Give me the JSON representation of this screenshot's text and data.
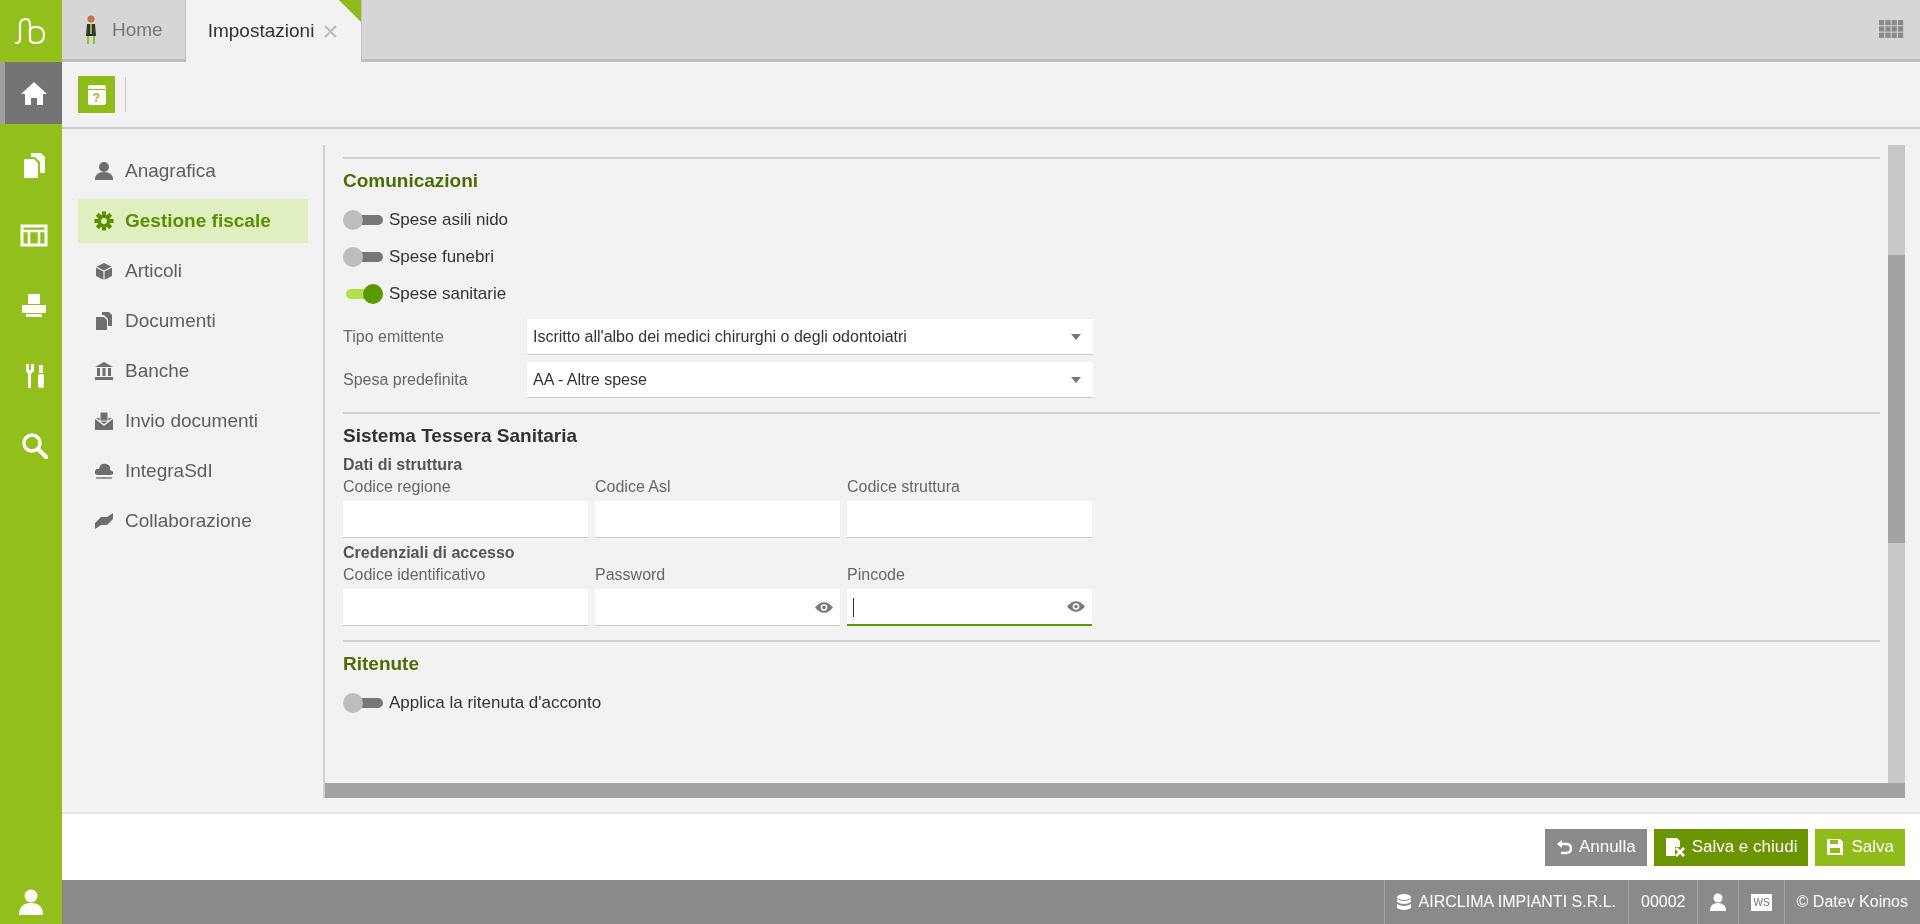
{
  "rail": [
    {
      "selected": true
    },
    {
      "selected": false
    },
    {
      "selected": false
    },
    {
      "selected": false
    },
    {
      "selected": false
    },
    {
      "selected": false
    }
  ],
  "tabs": [
    {
      "label": "Home",
      "selected": false,
      "closable": false
    },
    {
      "label": "Impostazioni",
      "selected": true,
      "closable": true
    }
  ],
  "help_button": {
    "label": "?"
  },
  "nav": [
    {
      "label": "Anagrafica",
      "selected": false
    },
    {
      "label": "Gestione fiscale",
      "selected": true
    },
    {
      "label": "Articoli",
      "selected": false
    },
    {
      "label": "Documenti",
      "selected": false
    },
    {
      "label": "Banche",
      "selected": false
    },
    {
      "label": "Invio documenti",
      "selected": false
    },
    {
      "label": "IntegraSdI",
      "selected": false
    },
    {
      "label": "Collaborazione",
      "selected": false
    }
  ],
  "sections": [
    {
      "title": "Comunicazioni",
      "accent": true,
      "toggles": [
        {
          "label": "Spese asili nido",
          "on": false
        },
        {
          "label": "Spese funebri",
          "on": false
        },
        {
          "label": "Spese sanitarie",
          "on": true
        }
      ],
      "selects": [
        {
          "label": "Tipo emittente",
          "value": "Iscritto all'albo dei medici chirurghi o degli odontoiatri"
        },
        {
          "label": "Spesa predefinita",
          "value": "AA - Altre spese"
        }
      ]
    },
    {
      "title": "Sistema Tessera Sanitaria",
      "accent": false,
      "groups": [
        {
          "title": "Dati di struttura",
          "fields": [
            {
              "label": "Codice regione",
              "reveal": false,
              "focused": false
            },
            {
              "label": "Codice Asl",
              "reveal": false,
              "focused": false
            },
            {
              "label": "Codice struttura",
              "reveal": false,
              "focused": false
            }
          ]
        },
        {
          "title": "Credenziali di accesso",
          "fields": [
            {
              "label": "Codice identificativo",
              "reveal": false,
              "focused": false
            },
            {
              "label": "Password",
              "reveal": true,
              "focused": false
            },
            {
              "label": "Pincode",
              "reveal": true,
              "focused": true
            }
          ]
        }
      ]
    },
    {
      "title": "Ritenute",
      "accent": true,
      "toggles": [
        {
          "label": "Applica la ritenuta d'acconto",
          "on": false
        }
      ]
    }
  ],
  "buttons": [
    {
      "label": "Annulla",
      "kind": "cancel"
    },
    {
      "label": "Salva e chiudi",
      "kind": "save_close"
    },
    {
      "label": "Salva",
      "kind": "save"
    }
  ],
  "status_bar": {
    "company": "AIRCLIMA IMPIANTI S.R.L.",
    "code": "00002",
    "ws_badge": "WS",
    "copyright": "© Datev Koinos"
  }
}
